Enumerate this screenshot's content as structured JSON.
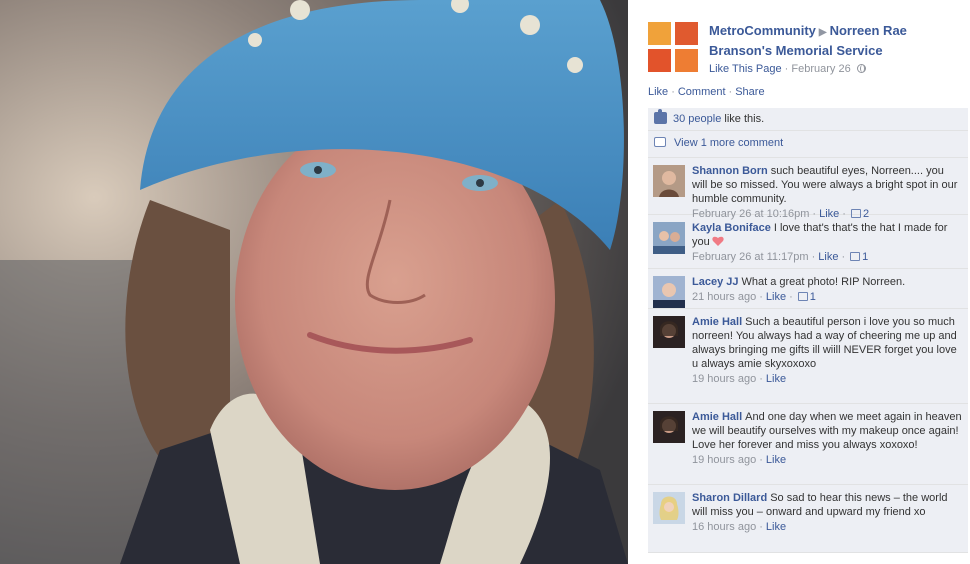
{
  "page": {
    "name": "MetroCommunity",
    "event": "Norreen Rae Branson's Memorial Service",
    "like_page": "Like This Page",
    "date": "February 26"
  },
  "actions": {
    "like": "Like",
    "comment": "Comment",
    "share": "Share"
  },
  "likes": {
    "count": "30 people",
    "suffix": "like this."
  },
  "view_more": "View 1 more comment",
  "comments": [
    {
      "author": "Shannon Born",
      "text": "such beautiful eyes, Norreen.... you will be so missed. You were always a bright spot in our humble community.",
      "time": "February 26 at 10:16pm",
      "like": "Like",
      "likes": "2"
    },
    {
      "author": "Kayla Boniface",
      "text": "I love that's that's the hat I made for you",
      "time": "February 26 at 11:17pm",
      "like": "Like",
      "likes": "1"
    },
    {
      "author": "Lacey JJ",
      "text": "What a great photo! RIP Norreen.",
      "time": "21 hours ago",
      "like": "Like",
      "likes": "1"
    },
    {
      "author": "Amie Hall",
      "text": "Such a beautiful person i love you so much norreen! You always had a way of cheering me up and always bringing me gifts ill wiill NEVER forget you love u always amie skyxoxoxo",
      "time": "19 hours ago",
      "like": "Like"
    },
    {
      "author": "Amie Hall",
      "text": "And one day when we meet again in heaven we will beautify ourselves with my makeup once again! Love her forever and miss you always xoxoxo!",
      "time": "19 hours ago",
      "like": "Like"
    },
    {
      "author": "Sharon Dillard",
      "text": "So sad to hear this news – the world will miss you – onward and upward my friend xo",
      "time": "16 hours ago",
      "like": "Like"
    }
  ],
  "colors": {
    "link": "#3b5998",
    "meta": "#90949c",
    "feedback_bg": "#edeff4"
  }
}
